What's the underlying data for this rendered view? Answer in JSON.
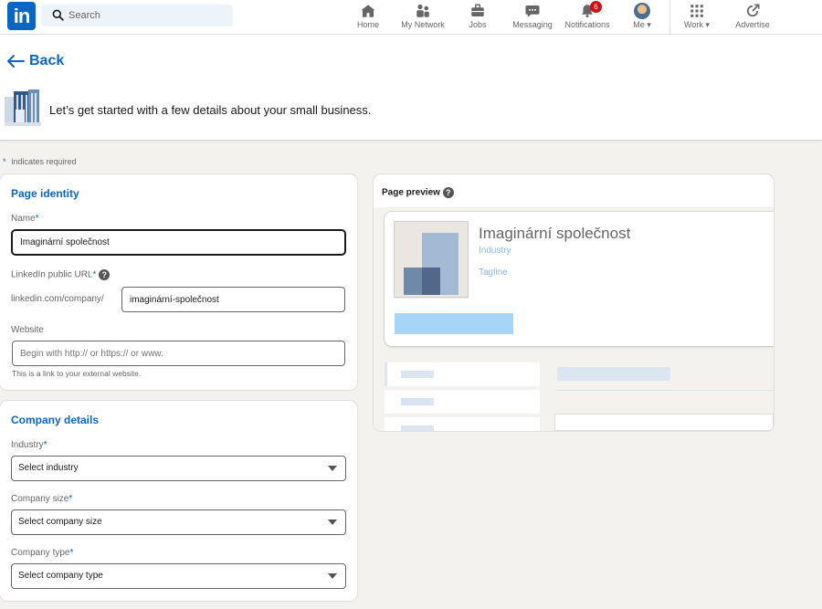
{
  "nav": {
    "logo": "in",
    "search_placeholder": "Search",
    "home": "Home",
    "network": "My Network",
    "jobs": "Jobs",
    "messaging": "Messaging",
    "notifications": "Notifications",
    "notifications_count": "6",
    "me": "Me",
    "work": "Work",
    "advertise": "Advertise"
  },
  "header": {
    "back": "Back",
    "intro": "Let’s get started with a few details about your small business."
  },
  "required_note": {
    "star": "*",
    "text": "indicates required"
  },
  "page_identity": {
    "title": "Page identity",
    "name_label": "Name",
    "name_value": "Imaginární společnost",
    "url_label": "LinkedIn public URL",
    "url_prefix": "linkedin.com/company/",
    "url_value": "imaginární-společnost",
    "website_label": "Website",
    "website_placeholder": "Begin with http:// or https:// or www.",
    "website_hint": "This is a link to your external website."
  },
  "company_details": {
    "title": "Company details",
    "industry_label": "Industry",
    "industry_value": "Select industry",
    "size_label": "Company size",
    "size_value": "Select company size",
    "type_label": "Company type",
    "type_value": "Select company type"
  },
  "preview": {
    "title": "Page preview",
    "name": "Imaginární společnost",
    "industry": "Industry",
    "tagline": "Tagline"
  },
  "colors": {
    "brand": "#0a66c2",
    "page_bg": "#f3f2ef",
    "badge": "#cc1016"
  }
}
